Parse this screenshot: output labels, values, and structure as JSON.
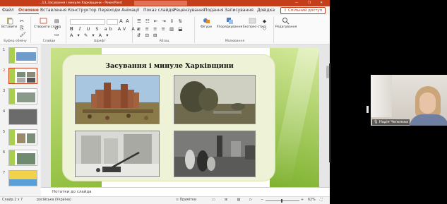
{
  "titlebar": {
    "doc_title": "…13_Засування і минуле Харківщини - PowerPoint",
    "window_controls": "— ❐ ✕"
  },
  "tabs": [
    "Файл",
    "Основне",
    "Вставлення",
    "Конструктор",
    "Переходи",
    "Анімації",
    "Показ слайдів",
    "Рецензування",
    "Подання",
    "Записування",
    "Довідка"
  ],
  "active_tab": "Основне",
  "share_label": "Спільний доступ",
  "ribbon": {
    "paste_label": "Вставити",
    "new_slide_label": "Створити слайд",
    "shapes_label": "Фігури",
    "arrange_label": "Упорядкування",
    "quick_styles_label": "Експрес-стилі",
    "editing_label": "Редагування",
    "groups": {
      "clipboard": "Буфер обміну",
      "slides": "Слайди",
      "font": "Шрифт",
      "paragraph": "Абзац",
      "drawing": "Малювання"
    }
  },
  "thumbnails": [
    "1",
    "2",
    "3",
    "4",
    "5",
    "6",
    "7"
  ],
  "selected_thumbnail": "2",
  "slide": {
    "title": "Засування і минуле Харківщини"
  },
  "notes_placeholder": "Нотатки до слайда",
  "status": {
    "slide_counter": "Слайд 2 з 7",
    "language": "російська (Україна)",
    "notes": "Примітки",
    "zoom": "62%"
  },
  "video": {
    "participant_name": "Надія Чепелєва"
  },
  "colors": {
    "accent": "#c43e1c",
    "slide_green": "#8fbd3a"
  }
}
